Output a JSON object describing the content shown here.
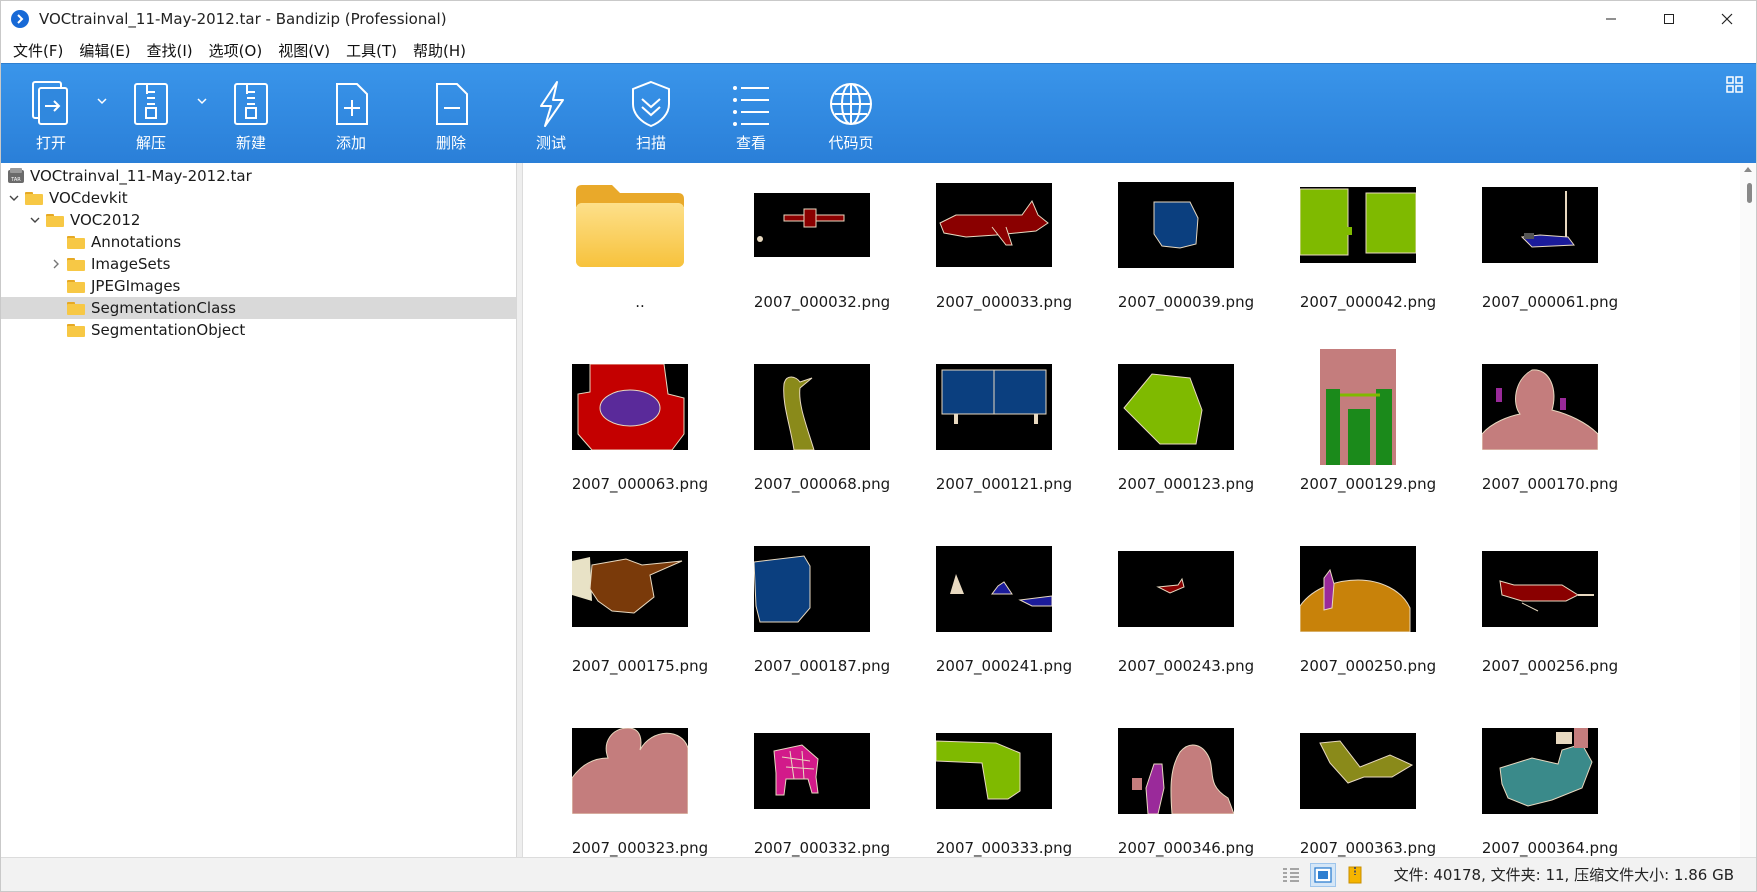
{
  "window": {
    "title": "VOCtrainval_11-May-2012.tar - Bandizip (Professional)"
  },
  "menu": [
    "文件(F)",
    "编辑(E)",
    "查找(I)",
    "选项(O)",
    "视图(V)",
    "工具(T)",
    "帮助(H)"
  ],
  "toolbar": {
    "open": "打开",
    "extract": "解压",
    "new": "新建",
    "add": "添加",
    "delete": "删除",
    "test": "测试",
    "scan": "扫描",
    "view": "查看",
    "codepage": "代码页"
  },
  "tree": {
    "root": "VOCtrainval_11-May-2012.tar",
    "items": [
      {
        "label": "VOCdevkit",
        "depth": 1,
        "expander": "open"
      },
      {
        "label": "VOC2012",
        "depth": 2,
        "expander": "open"
      },
      {
        "label": "Annotations",
        "depth": 3,
        "expander": "none"
      },
      {
        "label": "ImageSets",
        "depth": 3,
        "expander": "closed"
      },
      {
        "label": "JPEGImages",
        "depth": 3,
        "expander": "none"
      },
      {
        "label": "SegmentationClass",
        "depth": 3,
        "expander": "none",
        "selected": true
      },
      {
        "label": "SegmentationObject",
        "depth": 3,
        "expander": "none"
      }
    ]
  },
  "files": [
    {
      "name": "..",
      "kind": "folder"
    },
    {
      "name": "2007_000032.png",
      "kind": "thumb"
    },
    {
      "name": "2007_000033.png",
      "kind": "thumb"
    },
    {
      "name": "2007_000039.png",
      "kind": "thumb"
    },
    {
      "name": "2007_000042.png",
      "kind": "thumb"
    },
    {
      "name": "2007_000061.png",
      "kind": "thumb"
    },
    {
      "name": "2007_000063.png",
      "kind": "thumb"
    },
    {
      "name": "2007_000068.png",
      "kind": "thumb"
    },
    {
      "name": "2007_000121.png",
      "kind": "thumb"
    },
    {
      "name": "2007_000123.png",
      "kind": "thumb"
    },
    {
      "name": "2007_000129.png",
      "kind": "thumb"
    },
    {
      "name": "2007_000170.png",
      "kind": "thumb"
    },
    {
      "name": "2007_000175.png",
      "kind": "thumb"
    },
    {
      "name": "2007_000187.png",
      "kind": "thumb"
    },
    {
      "name": "2007_000241.png",
      "kind": "thumb"
    },
    {
      "name": "2007_000243.png",
      "kind": "thumb"
    },
    {
      "name": "2007_000250.png",
      "kind": "thumb"
    },
    {
      "name": "2007_000256.png",
      "kind": "thumb"
    },
    {
      "name": "2007_000323.png",
      "kind": "thumb"
    },
    {
      "name": "2007_000332.png",
      "kind": "thumb"
    },
    {
      "name": "2007_000333.png",
      "kind": "thumb"
    },
    {
      "name": "2007_000346.png",
      "kind": "thumb"
    },
    {
      "name": "2007_000363.png",
      "kind": "thumb"
    },
    {
      "name": "2007_000364.png",
      "kind": "thumb"
    }
  ],
  "status": {
    "text": "文件: 40178, 文件夹: 11, 压缩文件大小: 1.86 GB"
  },
  "colors": {
    "toolbar_top": "#3a95ea",
    "toolbar_bottom": "#2a7fd8",
    "folder": "#f7c845",
    "selected_row": "#d9d9d9"
  }
}
